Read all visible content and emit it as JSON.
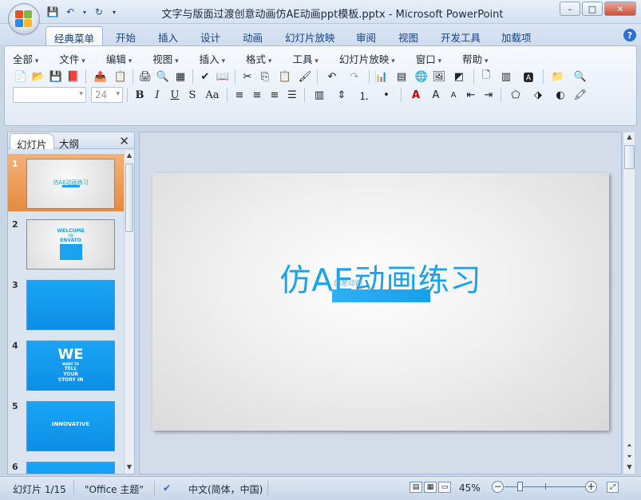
{
  "window": {
    "title": "文字与版面过渡创意动画仿AE动画ppt模板.pptx - Microsoft PowerPoint",
    "controls": [
      "–",
      "□",
      "✕"
    ]
  },
  "ribbon_tabs": [
    "经典菜单",
    "开始",
    "插入",
    "设计",
    "动画",
    "幻灯片放映",
    "审阅",
    "视图",
    "开发工具",
    "加载项"
  ],
  "menus": [
    "全部",
    "文件",
    "编辑",
    "视图",
    "插入",
    "格式",
    "工具",
    "幻灯片放映",
    "窗口",
    "帮助"
  ],
  "font": {
    "name_value": "",
    "size_value": "24"
  },
  "format_buttons": [
    "B",
    "I",
    "U",
    "S",
    "Aa"
  ],
  "panel": {
    "tabs": [
      "幻灯片",
      "大纲"
    ],
    "close": "✕",
    "slides": [
      {
        "num": "1",
        "title": "仿AE动画练习"
      },
      {
        "num": "2",
        "text1": "WELCOME",
        "text2": "TO",
        "text3": "ENVATO"
      },
      {
        "num": "3"
      },
      {
        "num": "4",
        "big": "WE",
        "l1": "WANT TO",
        "l2": "TELL",
        "l3": "YOUR",
        "l4": "STORY IN"
      },
      {
        "num": "5",
        "text": "INNOVATIVE"
      },
      {
        "num": "6"
      }
    ]
  },
  "slide": {
    "title": "仿AE动画练习",
    "subtitle": "创意动画"
  },
  "status": {
    "slide_info": "幻灯片 1/15",
    "theme": "\"Office 主题\"",
    "language": "中文(简体，中国)",
    "zoom": "45%",
    "zoom_level": 0.45
  },
  "colors": {
    "accent_blue": "#19a3ee",
    "selected_thumb": "#e58a3f"
  }
}
